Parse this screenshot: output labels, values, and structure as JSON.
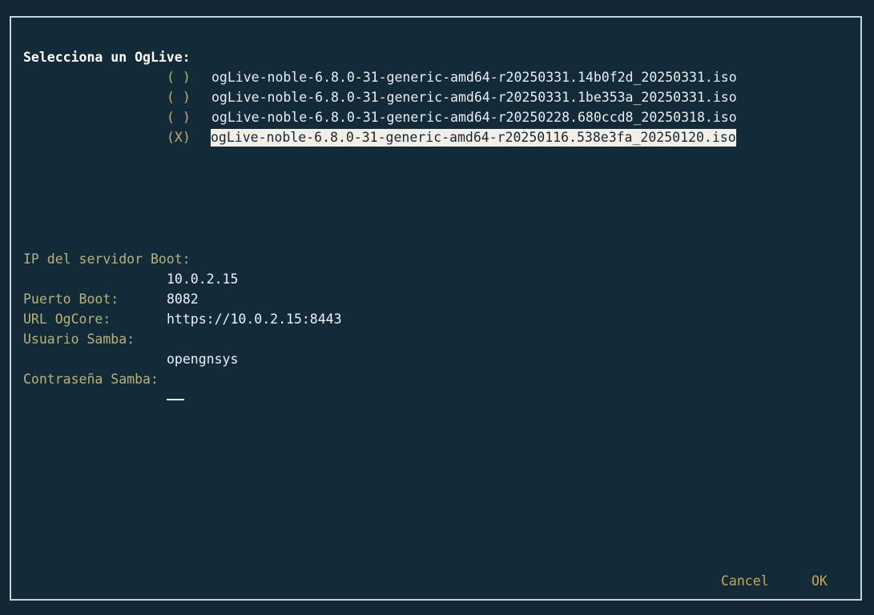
{
  "prompt": {
    "title": "Selecciona un OgLive:"
  },
  "options": [
    {
      "mark": "( )",
      "label": "ogLive-noble-6.8.0-31-generic-amd64-r20250331.14b0f2d_20250331.iso"
    },
    {
      "mark": "( )",
      "label": "ogLive-noble-6.8.0-31-generic-amd64-r20250331.1be353a_20250331.iso"
    },
    {
      "mark": "( )",
      "label": "ogLive-noble-6.8.0-31-generic-amd64-r20250228.680ccd8_20250318.iso"
    },
    {
      "mark": "(X)",
      "label": "ogLive-noble-6.8.0-31-generic-amd64-r20250116.538e3fa_20250120.iso"
    }
  ],
  "fields": {
    "boot_ip_label": "IP del servidor Boot:",
    "boot_ip_value": "10.0.2.15",
    "boot_port_label": "Puerto Boot:",
    "boot_port_value": "8082",
    "ogcore_url_label": "URL OgCore:",
    "ogcore_url_value": "https://10.0.2.15:8443",
    "samba_user_label": "Usuario Samba:",
    "samba_user_value": "opengnsys",
    "samba_password_label": "Contraseña Samba:"
  },
  "buttons": {
    "cancel": "Cancel",
    "ok": "OK"
  },
  "colors": {
    "background": "#132a38",
    "border": "#c7d3d9",
    "label_yellow": "#b7b27a",
    "button_gold": "#c9a556",
    "selected_bg": "#f3efe6"
  }
}
